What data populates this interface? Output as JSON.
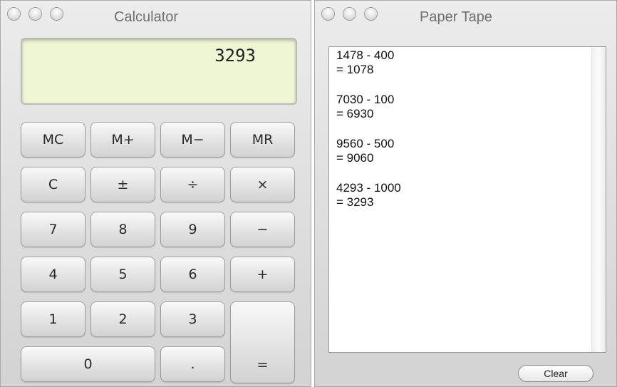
{
  "calculator": {
    "title": "Calculator",
    "display_value": "3293",
    "keys": {
      "mc": "MC",
      "mplus": "M+",
      "mminus": "M−",
      "mr": "MR",
      "clear": "C",
      "sign": "±",
      "divide": "÷",
      "multiply": "×",
      "seven": "7",
      "eight": "8",
      "nine": "9",
      "minus": "−",
      "four": "4",
      "five": "5",
      "six": "6",
      "plus": "+",
      "one": "1",
      "two": "2",
      "three": "3",
      "equals": "=",
      "zero": "0",
      "decimal": "."
    }
  },
  "paper_tape": {
    "title": "Paper Tape",
    "entries": [
      {
        "expression": "1478 - 400",
        "result": "= 1078"
      },
      {
        "expression": "7030 - 100",
        "result": "= 6930"
      },
      {
        "expression": "9560 - 500",
        "result": "= 9060"
      },
      {
        "expression": "4293 - 1000",
        "result": "= 3293"
      }
    ],
    "clear_label": "Clear"
  }
}
